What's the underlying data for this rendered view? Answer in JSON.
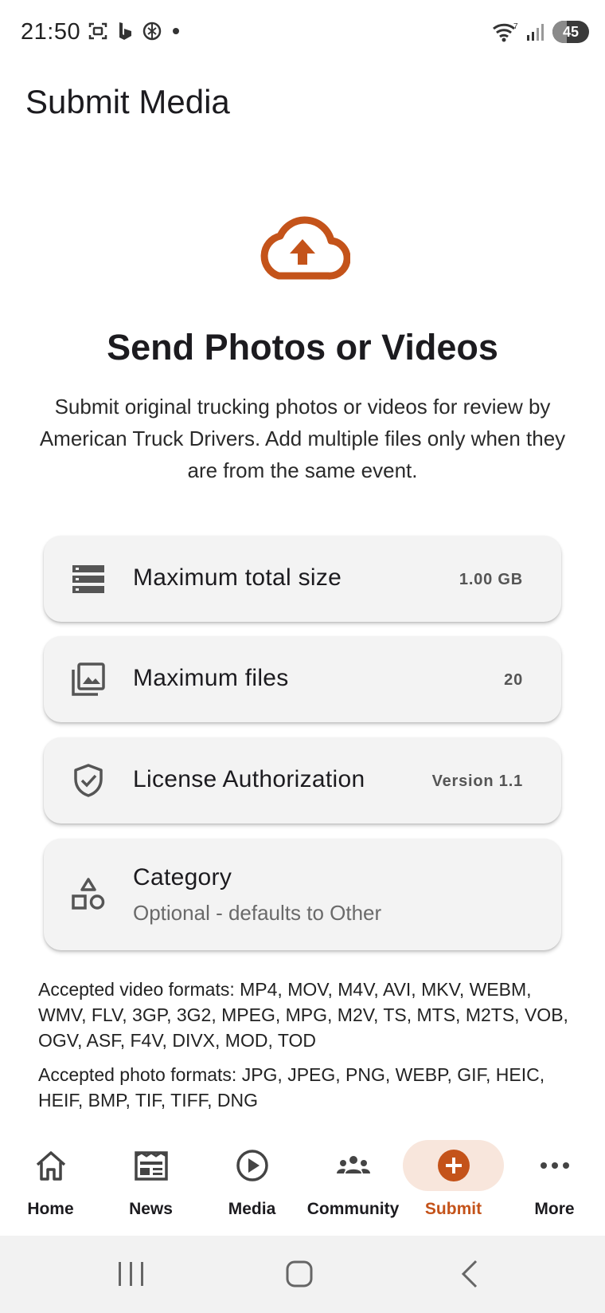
{
  "status_bar": {
    "time": "21:50",
    "battery": "45",
    "left_icons": [
      "screenshot-icon",
      "bing-icon",
      "chatgpt-icon",
      "dot-icon"
    ],
    "right_icons": [
      "wifi-icon",
      "signal-icon",
      "battery-icon"
    ]
  },
  "header": {
    "title": "Submit Media"
  },
  "hero": {
    "icon": "cloud-upload-icon",
    "title": "Send Photos or Videos",
    "description": "Submit original trucking photos or videos for review by American Truck Drivers. Add multiple files only when they are from the same event."
  },
  "cards": [
    {
      "icon": "storage-icon",
      "label": "Maximum total size",
      "value": "1.00 GB"
    },
    {
      "icon": "photo-library-icon",
      "label": "Maximum files",
      "value": "20"
    },
    {
      "icon": "verified-shield-icon",
      "label": "License Authorization",
      "value": "Version 1.1"
    },
    {
      "icon": "category-icon",
      "label": "Category",
      "sublabel": "Optional - defaults to Other"
    }
  ],
  "formats": {
    "video": "Accepted video formats: MP4, MOV, M4V, AVI, MKV, WEBM, WMV, FLV, 3GP, 3G2, MPEG, MPG, M2V, TS, MTS, M2TS, VOB, OGV, ASF, F4V, DIVX, MOD, TOD",
    "photo": "Accepted photo formats: JPG, JPEG, PNG, WEBP, GIF, HEIC, HEIF, BMP, TIF, TIFF, DNG"
  },
  "bottom_nav": {
    "active": "Submit",
    "items": [
      {
        "label": "Home",
        "icon": "home-icon"
      },
      {
        "label": "News",
        "icon": "newspaper-icon"
      },
      {
        "label": "Media",
        "icon": "play-circle-icon"
      },
      {
        "label": "Community",
        "icon": "people-icon"
      },
      {
        "label": "Submit",
        "icon": "add-circle-icon"
      },
      {
        "label": "More",
        "icon": "more-horizontal-icon"
      }
    ]
  },
  "system_nav": [
    "recents-icon",
    "home-button-icon",
    "back-icon"
  ],
  "colors": {
    "accent": "#c4531a",
    "accent_soft": "#f8e6dc",
    "card_bg": "#f3f3f3",
    "text": "#1c1b1f"
  }
}
